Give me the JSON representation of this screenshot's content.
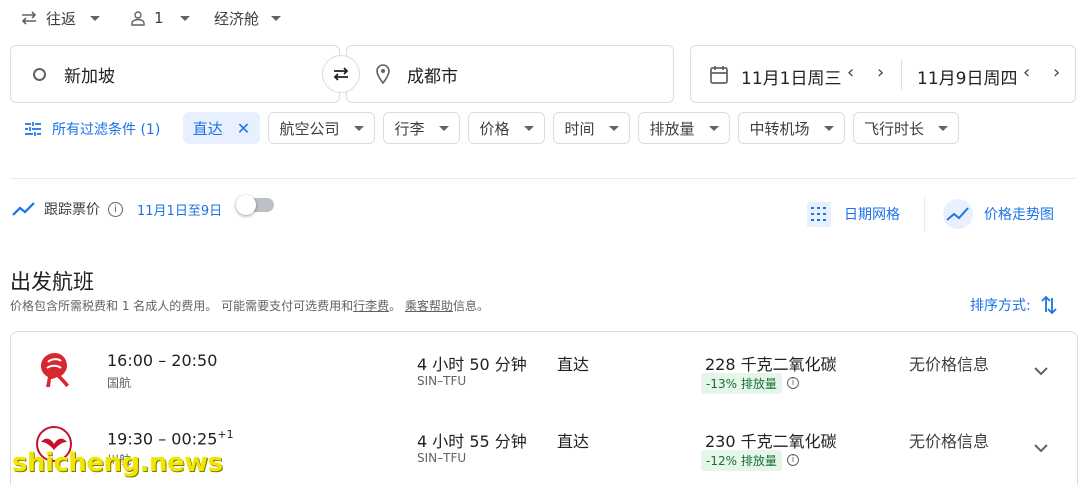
{
  "top_options": {
    "trip_type": "往返",
    "passengers": "1",
    "cabin": "经济舱"
  },
  "search": {
    "origin": "新加坡",
    "destination": "成都市",
    "depart_date": "11月1日周三",
    "return_date": "11月9日周四"
  },
  "filters": {
    "all_filters": "所有过滤条件 (1)",
    "chips": [
      "直达",
      "航空公司",
      "行李",
      "价格",
      "时间",
      "排放量",
      "中转机场",
      "飞行时长"
    ]
  },
  "tracking": {
    "label": "跟踪票价",
    "dates": "11月1日至9日",
    "enabled": false
  },
  "tools": {
    "date_grid": "日期网格",
    "price_graph": "价格走势图"
  },
  "results": {
    "heading": "出发航班",
    "note_prefix": "价格包含所需税费和 1 名成人的费用。 可能需要支付可选费用和",
    "baggage_fees": "行李费",
    "note_mid": "。",
    "passenger_help": "乘客帮助",
    "note_suffix": "信息。",
    "sort_label": "排序方式:"
  },
  "flights": [
    {
      "times": "16:00 – 20:50",
      "plus_day": "",
      "airline": "国航",
      "duration": "4 小时 50 分钟",
      "route": "SIN–TFU",
      "stops": "直达",
      "emissions": "228 千克二氧化碳",
      "emissions_badge": "-13% 排放量",
      "price": "无价格信息"
    },
    {
      "times": "19:30 – 00:25",
      "plus_day": "+1",
      "airline": "川航",
      "duration": "4 小时 55 分钟",
      "route": "SIN–TFU",
      "stops": "直达",
      "emissions": "230 千克二氧化碳",
      "emissions_badge": "-12% 排放量",
      "price": "无价格信息"
    }
  ],
  "watermark": "shicheng.news",
  "colors": {
    "accent": "#1a73e8",
    "chip_active_bg": "#e8f0fe",
    "emission_badge_bg": "#e6f4ea",
    "emission_badge_text": "#137333"
  }
}
